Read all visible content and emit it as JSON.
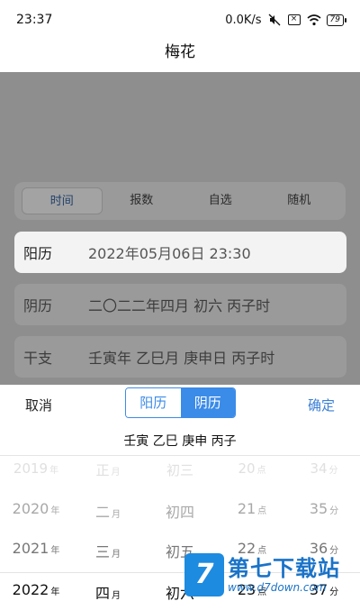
{
  "status_bar": {
    "time": "23:37",
    "network_speed": "0.0K/s",
    "icons": [
      "mute-icon",
      "sim-off-icon",
      "wifi-icon"
    ],
    "battery": "79"
  },
  "header": {
    "title": "梅花"
  },
  "mode_tabs": [
    {
      "label": "时间",
      "active": true
    },
    {
      "label": "报数",
      "active": false
    },
    {
      "label": "自选",
      "active": false
    },
    {
      "label": "随机",
      "active": false
    }
  ],
  "rows": {
    "solar": {
      "label": "阳历",
      "value": "2022年05月06日 23:30"
    },
    "lunar": {
      "label": "阴历",
      "value": "二〇二二年四月 初六 丙子时"
    },
    "ganzhi": {
      "label": "干支",
      "value": "壬寅年 乙巳月 庚申日 丙子时"
    }
  },
  "sheet": {
    "cancel_label": "取消",
    "confirm_label": "确定",
    "calendar_options": [
      {
        "label": "阳历",
        "active": false
      },
      {
        "label": "阴历",
        "active": true
      }
    ],
    "ganzhi_summary": "壬寅 乙巳 庚申 丙子"
  },
  "picker": {
    "year": {
      "items": [
        "2019",
        "2020",
        "2021",
        "2022"
      ],
      "unit": "年"
    },
    "month": {
      "items": [
        "正",
        "二",
        "三",
        "四"
      ],
      "unit": "月"
    },
    "day": {
      "items": [
        "初三",
        "初四",
        "初五",
        "初六"
      ],
      "unit": ""
    },
    "hour": {
      "items": [
        "20",
        "21",
        "22",
        "23"
      ],
      "unit": "点"
    },
    "minute": {
      "items": [
        "34",
        "35",
        "36",
        "37"
      ],
      "unit": "分"
    }
  },
  "watermark": {
    "name": "第七下载站",
    "url": "www.d7down.com"
  }
}
